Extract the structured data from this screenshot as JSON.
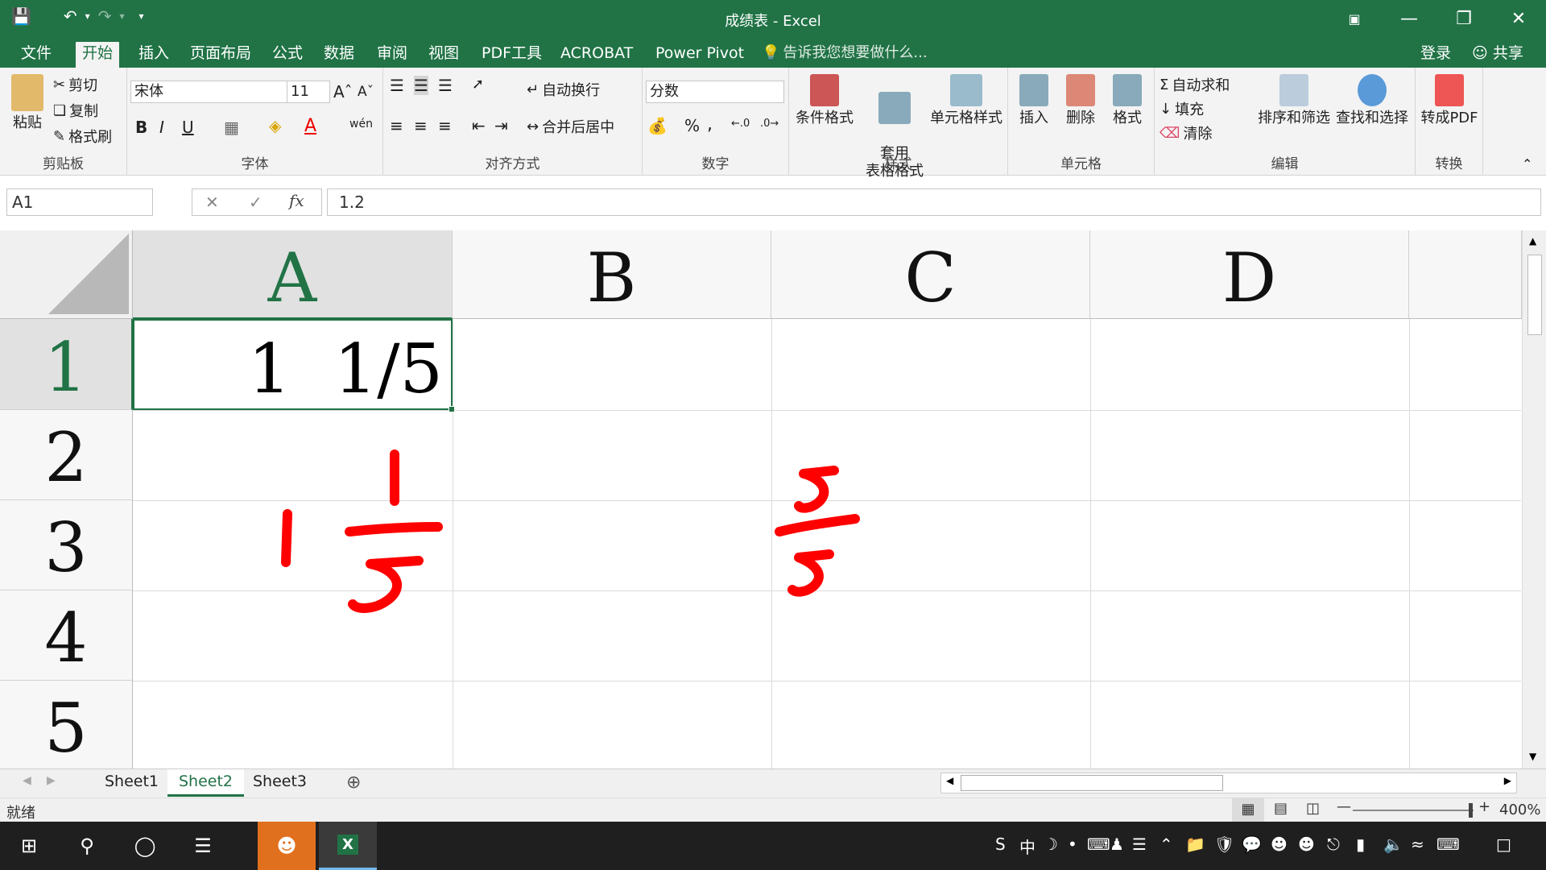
{
  "window": {
    "title": "成绩表 - Excel"
  },
  "tabs": [
    {
      "label": "文件"
    },
    {
      "label": "开始"
    },
    {
      "label": "插入"
    },
    {
      "label": "页面布局"
    },
    {
      "label": "公式"
    },
    {
      "label": "数据"
    },
    {
      "label": "审阅"
    },
    {
      "label": "视图"
    },
    {
      "label": "PDF工具"
    },
    {
      "label": "ACROBAT"
    },
    {
      "label": "Power Pivot"
    }
  ],
  "tellme": "告诉我您想要做什么...",
  "login": "登录",
  "share": "共享",
  "ribbon": {
    "clipboard": {
      "paste": "粘贴",
      "cut": "剪切",
      "copy": "复制",
      "format_painter": "格式刷",
      "label": "剪贴板"
    },
    "font": {
      "name": "宋体",
      "size": "11",
      "bold": "B",
      "italic": "I",
      "underline": "U",
      "label": "字体",
      "phonetic": "wén"
    },
    "alignment": {
      "wrap": "自动换行",
      "merge": "合并后居中",
      "label": "对齐方式"
    },
    "number": {
      "format": "分数",
      "percent": "%",
      "comma": ",",
      "label": "数字"
    },
    "styles": {
      "cond": "条件格式",
      "table": "套用\n表格格式",
      "cell": "单元格样式",
      "label": "样式"
    },
    "cells": {
      "insert": "插入",
      "delete": "删除",
      "format": "格式",
      "label": "单元格"
    },
    "editing": {
      "autosum": "自动求和",
      "fill": "填充",
      "clear": "清除",
      "sort": "排序和筛选",
      "find": "查找和选择",
      "label": "编辑"
    },
    "convert": {
      "topdf": "转成PDF",
      "label": "转换"
    }
  },
  "formula": {
    "namebox": "A1",
    "fx": "fx",
    "value": "1.2"
  },
  "columns": [
    "A",
    "B",
    "C",
    "D"
  ],
  "rows": [
    "1",
    "2",
    "3",
    "4",
    "5"
  ],
  "cells": {
    "A1": "1  1/5"
  },
  "sheets": [
    "Sheet1",
    "Sheet2",
    "Sheet3"
  ],
  "active_sheet": "Sheet2",
  "status": {
    "ready": "就绪",
    "zoom": "400%"
  },
  "annotation_color": "#ff0000",
  "accent": "#217346"
}
